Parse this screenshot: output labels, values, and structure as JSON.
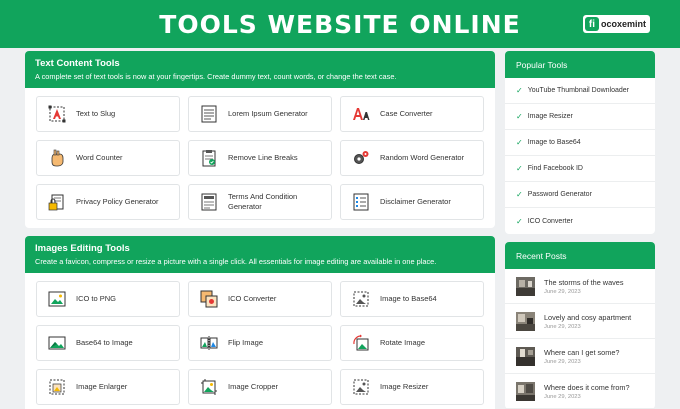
{
  "header": {
    "title": "TOOLS WEBSITE ONLINE",
    "brand_mark": "fi",
    "brand_name": "ocoxemint"
  },
  "sections": [
    {
      "title": "Text Content Tools",
      "description": "A complete set of text tools is now at your fingertips. Create dummy text, count words, or change the text case.",
      "tools": [
        {
          "label": "Text to Slug",
          "icon": "text-slug-icon"
        },
        {
          "label": "Lorem Ipsum Generator",
          "icon": "lorem-document-icon"
        },
        {
          "label": "Case Converter",
          "icon": "case-aa-icon"
        },
        {
          "label": "Word Counter",
          "icon": "hand-counter-icon"
        },
        {
          "label": "Remove Line Breaks",
          "icon": "clipboard-check-icon"
        },
        {
          "label": "Random Word Generator",
          "icon": "gears-icon"
        },
        {
          "label": "Privacy Policy Generator",
          "icon": "privacy-lock-icon"
        },
        {
          "label": "Terms And Condition Generator",
          "icon": "terms-document-icon"
        },
        {
          "label": "Disclaimer Generator",
          "icon": "disclaimer-list-icon"
        }
      ]
    },
    {
      "title": "Images Editing Tools",
      "description": "Create a favicon, compress or resize a picture with a single click. All essentials for image editing are available in one place.",
      "tools": [
        {
          "label": "ICO to PNG",
          "icon": "ico-to-png-icon"
        },
        {
          "label": "ICO Converter",
          "icon": "ico-converter-icon"
        },
        {
          "label": "Image to Base64",
          "icon": "image-base64-icon"
        },
        {
          "label": "Base64 to Image",
          "icon": "base64-image-icon"
        },
        {
          "label": "Flip Image",
          "icon": "flip-image-icon"
        },
        {
          "label": "Rotate Image",
          "icon": "rotate-image-icon"
        },
        {
          "label": "Image Enlarger",
          "icon": "image-enlarger-icon"
        },
        {
          "label": "Image Cropper",
          "icon": "image-cropper-icon"
        },
        {
          "label": "Image Resizer",
          "icon": "image-resizer-icon"
        }
      ]
    }
  ],
  "popular_tools": {
    "title": "Popular Tools",
    "items": [
      "YouTube Thumbnail Downloader",
      "Image Resizer",
      "Image to Base64",
      "Find Facebook ID",
      "Password Generator",
      "ICO Converter"
    ]
  },
  "recent_posts": {
    "title": "Recent Posts",
    "items": [
      {
        "title": "The storms of the waves",
        "date": "June 29, 2023"
      },
      {
        "title": "Lovely and cosy apartment",
        "date": "June 29, 2023"
      },
      {
        "title": "Where can I get some?",
        "date": "June 29, 2023"
      },
      {
        "title": "Where does it come from?",
        "date": "June 29, 2023"
      }
    ]
  },
  "colors": {
    "accent": "#11a45c",
    "background": "#eef0f2"
  }
}
